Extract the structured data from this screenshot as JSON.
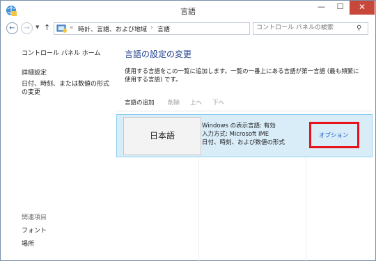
{
  "window": {
    "title": "言語",
    "minimize_glyph": "—",
    "maximize_glyph": "☐",
    "close_glyph": "✕"
  },
  "address_bar": {
    "back_glyph": "←",
    "forward_glyph": "→",
    "dropdown_glyph": "▼",
    "up_glyph": "↑",
    "separator": "«",
    "separator2": "›",
    "breadcrumb": [
      "時計、言語、および地域",
      "言語"
    ],
    "refresh_glyph": "↻",
    "search_placeholder": "コントロール パネルの検索",
    "search_glyph": "⚲"
  },
  "left_panel": {
    "home": "コントロール パネル ホーム",
    "advanced": "詳細設定",
    "date_time_format": "日付、時刻、または数値の形式の変更",
    "related_heading": "関連項目",
    "fonts": "フォント",
    "location": "場所"
  },
  "main": {
    "title": "言語の設定の変更",
    "description": "使用する言語をこの一覧に追加します。一覧の一番上にある言語が第一言語 (最も頻繁に使用する言語) です。",
    "toolbar": {
      "add": "言語の追加",
      "remove": "削除",
      "up": "上へ",
      "down": "下へ"
    },
    "languages": [
      {
        "name": "日本語",
        "info_line1": "Windows の表示言語: 有効",
        "info_line2": "入力方式: Microsoft IME",
        "info_line3": "日付、時刻、および数値の形式",
        "options_label": "オプション"
      }
    ]
  },
  "colors": {
    "title_blue": "#1c3e8c",
    "link_blue": "#1a57c6",
    "selection_bg": "#d9edf9",
    "selection_border": "#8ccdf0",
    "highlight_red": "#e8121b",
    "close_button": "#c7483b"
  },
  "icons": [
    "app-icon",
    "back-icon",
    "forward-icon",
    "history-dropdown-icon",
    "up-icon",
    "control-panel-icon",
    "address-dropdown-icon",
    "refresh-icon",
    "search-icon"
  ]
}
